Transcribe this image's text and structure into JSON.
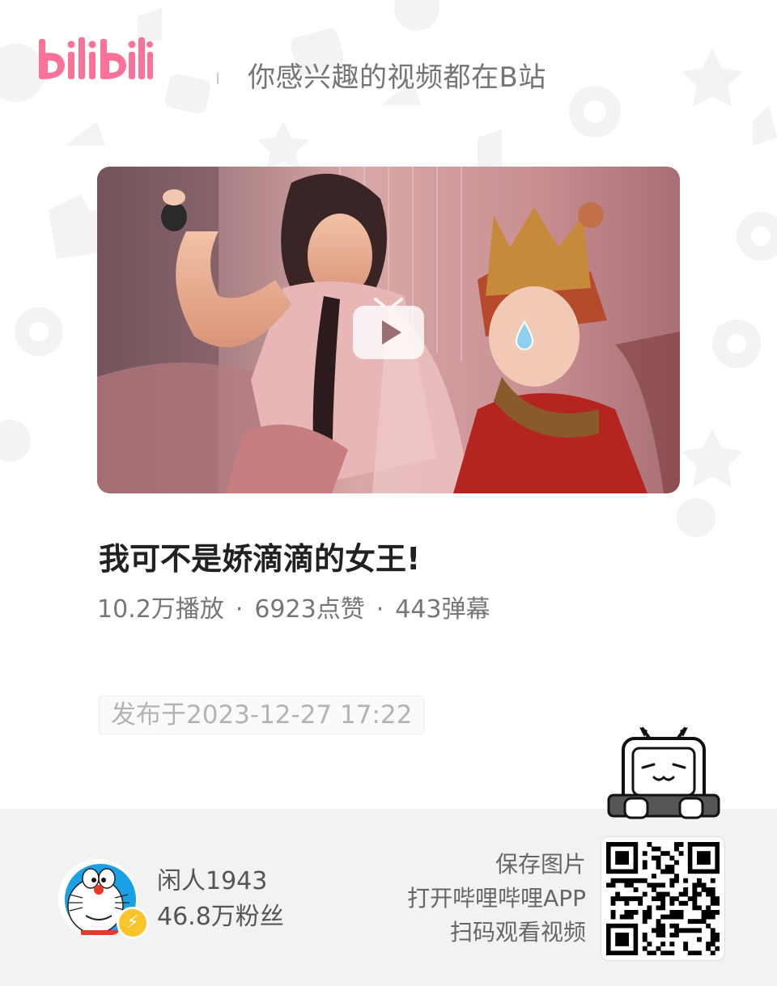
{
  "header": {
    "logo_text": "bilibili",
    "tagline": "你感兴趣的视频都在B站"
  },
  "video": {
    "title": "我可不是娇滴滴的女王!",
    "views": "10.2万播放",
    "likes": "6923点赞",
    "danmaku": "443弹幕",
    "separator": "·",
    "published": "发布于2023-12-27 17:22"
  },
  "uploader": {
    "name": "闲人1943",
    "fans": "46.8万粉丝"
  },
  "qr": {
    "line1": "保存图片",
    "line2": "打开哔哩哔哩APP",
    "line3": "扫码观看视频"
  },
  "colors": {
    "brand": "#fb7299",
    "badge": "#f9c52a"
  },
  "icons": [
    "bilibili-logo",
    "play-icon",
    "tv-mascot-icon",
    "lightning-badge-icon",
    "qr-code"
  ]
}
